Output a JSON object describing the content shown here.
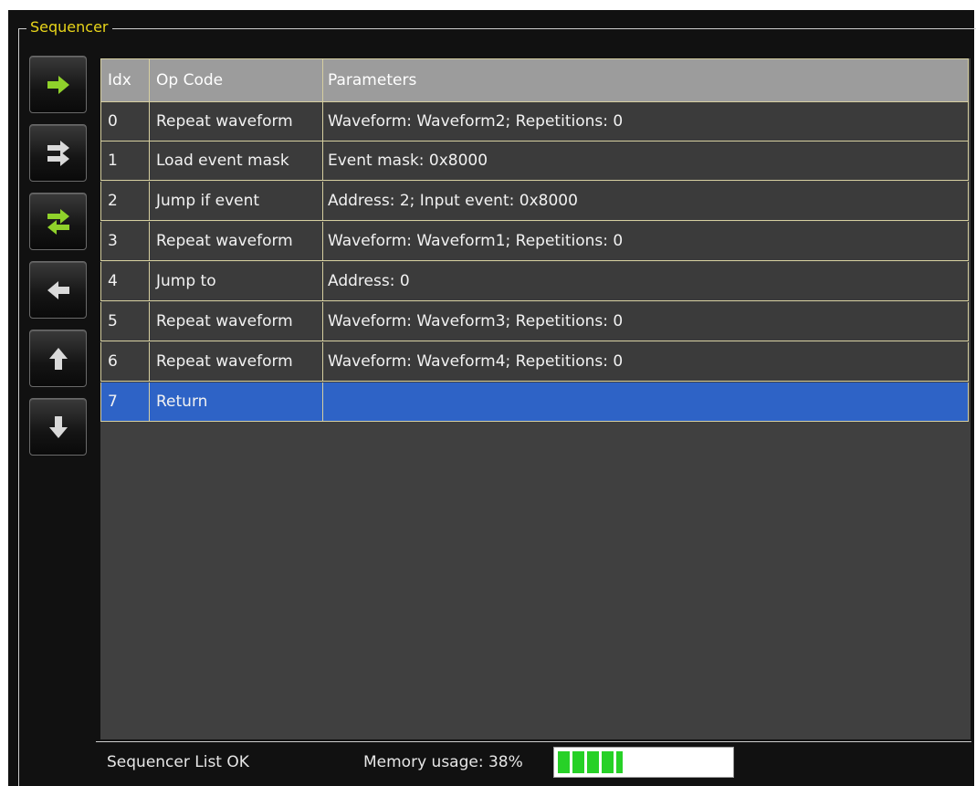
{
  "group_title": "Sequencer",
  "tools": [
    {
      "name": "insert-step-icon",
      "color": "#8fd12b"
    },
    {
      "name": "swap-icon",
      "color": "#d9d9d9"
    },
    {
      "name": "exchange-icon",
      "color": "#8fd12b"
    },
    {
      "name": "remove-step-icon",
      "color": "#d9d9d9"
    },
    {
      "name": "move-up-icon",
      "color": "#d9d9d9"
    },
    {
      "name": "move-down-icon",
      "color": "#d9d9d9"
    }
  ],
  "table": {
    "columns": [
      "Idx",
      "Op Code",
      "Parameters"
    ],
    "rows": [
      {
        "idx": "0",
        "op": "Repeat waveform",
        "params": "Waveform: Waveform2; Repetitions: 0"
      },
      {
        "idx": "1",
        "op": "Load event mask",
        "params": "Event mask: 0x8000"
      },
      {
        "idx": "2",
        "op": "Jump if event",
        "params": "Address: 2; Input event: 0x8000"
      },
      {
        "idx": "3",
        "op": "Repeat waveform",
        "params": "Waveform: Waveform1; Repetitions: 0"
      },
      {
        "idx": "4",
        "op": "Jump to",
        "params": "Address: 0"
      },
      {
        "idx": "5",
        "op": "Repeat waveform",
        "params": "Waveform: Waveform3; Repetitions: 0"
      },
      {
        "idx": "6",
        "op": "Repeat waveform",
        "params": "Waveform: Waveform4; Repetitions: 0"
      },
      {
        "idx": "7",
        "op": "Return",
        "params": "",
        "selected": true
      }
    ]
  },
  "status": {
    "list_status": "Sequencer List OK",
    "memory_label": "Memory usage: 38%",
    "memory_fraction": 0.38,
    "bar_color": "#27d127"
  },
  "colors": {
    "title": "#e8d51a",
    "selected_row": "#2e63c6",
    "header_row": "#9c9c9c"
  }
}
